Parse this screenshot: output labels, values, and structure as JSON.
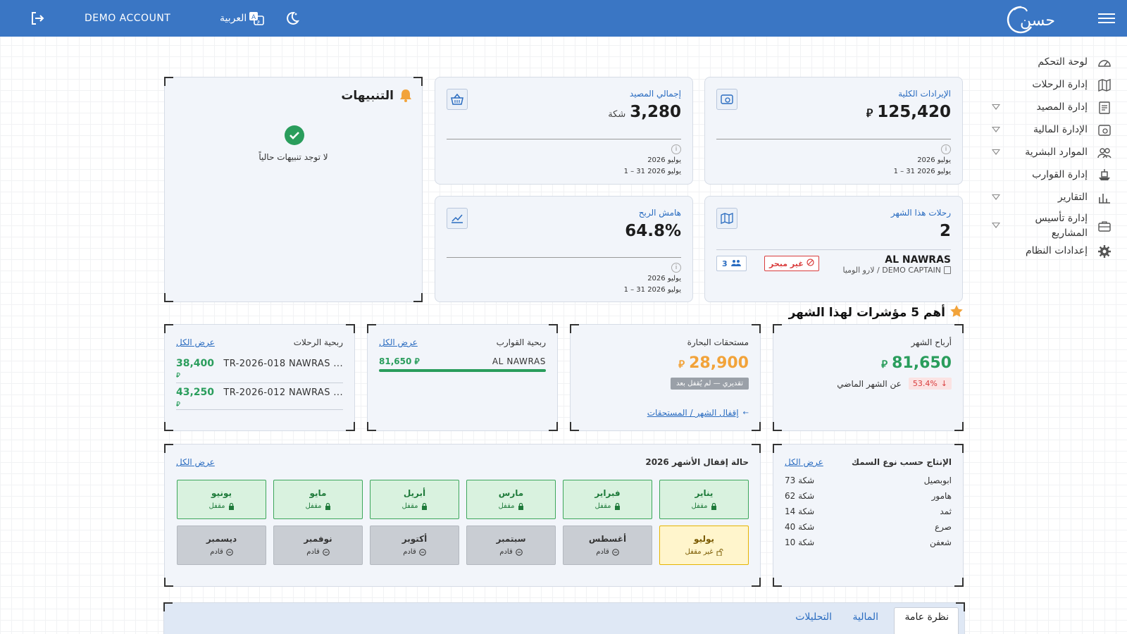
{
  "topbar": {
    "demo_label": "DEMO ACCOUNT",
    "lang_label": "العربية",
    "logo_text": "حسن"
  },
  "sidebar": {
    "items": [
      {
        "label": "لوحة التحكم",
        "icon": "gauge-icon"
      },
      {
        "label": "إدارة الرحلات",
        "icon": "map-icon"
      },
      {
        "label": "إدارة المصيد",
        "icon": "list-icon"
      },
      {
        "label": "الإدارة المالية",
        "icon": "finance-icon"
      },
      {
        "label": "الموارد البشرية",
        "icon": "users-icon"
      },
      {
        "label": "إدارة القوارب",
        "icon": "ship-icon"
      },
      {
        "label": "التقارير",
        "icon": "chart-icon"
      },
      {
        "label": "إدارة تأسيس المشاريع",
        "icon": "briefcase-icon"
      },
      {
        "label": "إعدادات النظام",
        "icon": "gear-icon"
      }
    ]
  },
  "alerts": {
    "title": "التنبيهات",
    "empty": "لا توجد تنبيهات حالياً"
  },
  "kpi": {
    "revenue": {
      "title": "الإيرادات الكلية",
      "value": "125,420",
      "currency": "⃁",
      "period": "يوليو 2026",
      "range": "1 – 31 يوليو 2026"
    },
    "catch": {
      "title": "إجمالي المصيد",
      "value": "3,280",
      "unit": "شكة",
      "period": "يوليو 2026",
      "range": "1 – 31 يوليو 2026"
    },
    "trips": {
      "title": "رحلات هذا الشهر",
      "value": "2",
      "boat": "AL NAWRAS",
      "captain": "لارو الوميا / DEMO CAPTAIN",
      "status": "غير مبحر",
      "crew": "3"
    },
    "margin": {
      "title": "هامش الربح",
      "value": "64.8%",
      "period": "يوليو 2026",
      "range": "1 – 31 يوليو 2026"
    }
  },
  "top5": {
    "title": "أهم 5 مؤشرات لهذا الشهر"
  },
  "profit": {
    "title": "أرباح الشهر",
    "value": "81,650",
    "currency": "⃁",
    "change": "53.4%",
    "change_label": "عن الشهر الماضي"
  },
  "sailors": {
    "title": "مستحقات البحارة",
    "value": "28,900",
    "currency": "⃁",
    "note": "تقديري — لم يُقفل بعد",
    "link": "إقفال الشهر / المستحقات"
  },
  "boats": {
    "title": "ربحية القوارب",
    "link": "عرض الكل",
    "rows": [
      {
        "name": "AL NAWRAS",
        "value": "81,650 ⃁"
      }
    ]
  },
  "trips_profit": {
    "title": "ربحية الرحلات",
    "link": "عرض الكل",
    "rows": [
      {
        "name": "TR-2026-018 NAWRAS ...",
        "value": "38,400",
        "cur": "⃁"
      },
      {
        "name": "TR-2026-012 NAWRAS ...",
        "value": "43,250",
        "cur": "⃁"
      }
    ]
  },
  "fish": {
    "title": "الإنتاج حسب نوع السمك",
    "link": "عرض الكل",
    "rows": [
      {
        "name": "ابوبصيل",
        "value": "73 شكة"
      },
      {
        "name": "هامور",
        "value": "62 شكة"
      },
      {
        "name": "ثمد",
        "value": "14 شكة"
      },
      {
        "name": "صرع",
        "value": "40 شكة"
      },
      {
        "name": "شعفن",
        "value": "10 شكة"
      }
    ]
  },
  "months": {
    "title": "حالة إقفال الأشهر 2026",
    "link": "عرض الكل",
    "items": [
      {
        "name": "يناير",
        "status": "مقفل",
        "state": "locked"
      },
      {
        "name": "فبراير",
        "status": "مقفل",
        "state": "locked"
      },
      {
        "name": "مارس",
        "status": "مقفل",
        "state": "locked"
      },
      {
        "name": "أبريل",
        "status": "مقفل",
        "state": "locked"
      },
      {
        "name": "مايو",
        "status": "مقفل",
        "state": "locked"
      },
      {
        "name": "يونيو",
        "status": "مقفل",
        "state": "locked"
      },
      {
        "name": "يوليو",
        "status": "غير مقفل",
        "state": "open"
      },
      {
        "name": "أغسطس",
        "status": "قادم",
        "state": "upcoming"
      },
      {
        "name": "سبتمبر",
        "status": "قادم",
        "state": "upcoming"
      },
      {
        "name": "أكتوبر",
        "status": "قادم",
        "state": "upcoming"
      },
      {
        "name": "نوفمبر",
        "status": "قادم",
        "state": "upcoming"
      },
      {
        "name": "ديسمبر",
        "status": "قادم",
        "state": "upcoming"
      }
    ]
  },
  "tabs": [
    "نظرة عامة",
    "المالية",
    "التحليلات"
  ],
  "colors": {
    "topbar": "#3a76c4",
    "accent": "#2a6cc0",
    "profit": "#2a9d5c",
    "warn": "#f2a33a",
    "danger": "#d93c3c"
  }
}
